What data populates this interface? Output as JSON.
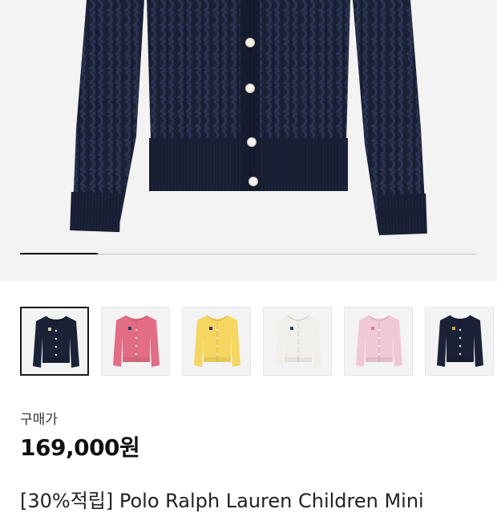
{
  "gallery": {
    "progress_fraction": 0.17,
    "thumbnails": [
      {
        "name": "thumb-navy",
        "color": "#1b2238",
        "logo": "#d8d0b0",
        "selected": true
      },
      {
        "name": "thumb-pink",
        "color": "#e26d85",
        "logo": "#2a3a6a",
        "selected": false
      },
      {
        "name": "thumb-yellow",
        "color": "#f6d561",
        "logo": "#2a3a6a",
        "selected": false
      },
      {
        "name": "thumb-white",
        "color": "#f0efe9",
        "logo": "#2a3a6a",
        "selected": false
      },
      {
        "name": "thumb-light-pink",
        "color": "#f1c8d6",
        "logo": "#d27a93",
        "selected": false
      },
      {
        "name": "thumb-navy-alt",
        "color": "#1b2238",
        "logo": "#c9a94a",
        "selected": false
      }
    ]
  },
  "product": {
    "price_label": "구매가",
    "price": "169,000원",
    "title": "[30%적립] Polo Ralph Lauren Children Mini"
  },
  "colors": {
    "cardigan_main": "#1b2238",
    "background": "#f3f3f3"
  }
}
